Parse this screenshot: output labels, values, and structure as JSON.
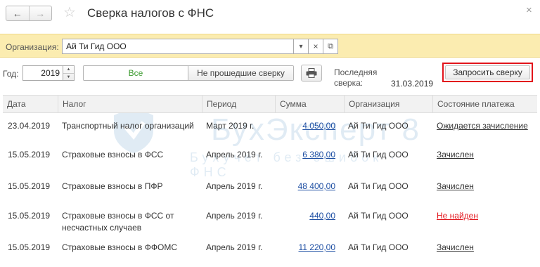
{
  "header": {
    "title": "Сверка налогов с ФНС",
    "back_icon": "←",
    "forward_icon": "→",
    "favorite_icon": "☆",
    "close_icon": "×"
  },
  "organization": {
    "label": "Организация:",
    "value": "Ай Ти Гид ООО",
    "dropdown_icon": "▾",
    "clear_icon": "×",
    "open_icon": "⧉"
  },
  "filters": {
    "year_label": "Год:",
    "year_value": "2019",
    "spin_up": "▲",
    "spin_down": "▼",
    "all_label": "Все",
    "failed_label": "Не прошедшие сверку",
    "last_label_line1": "Последняя",
    "last_label_line2": "сверка:",
    "last_date": "31.03.2019",
    "request_button": "Запросить сверку"
  },
  "watermark": {
    "title": "БухЭксперт 8",
    "subtitle": "Бухучет без ошибок  ·  ФНС"
  },
  "table": {
    "columns": [
      "Дата",
      "Налог",
      "Период",
      "Сумма",
      "Организация",
      "Состояние платежа"
    ],
    "rows": [
      {
        "date": "23.04.2019",
        "tax": "Транспортный налог организаций",
        "tax2": "",
        "period": "Март 2019 г.",
        "sum": "4 050,00",
        "org": "Ай Ти Гид ООО",
        "status": "Ожидается зачисление",
        "status_color": "#333333"
      },
      {
        "date": "15.05.2019",
        "tax": "Страховые взносы в ФСС",
        "tax2": "",
        "period": "Апрель 2019 г.",
        "sum": "6 380,00",
        "org": "Ай Ти Гид ООО",
        "status": "Зачислен",
        "status_color": "#333333"
      },
      {
        "date": "15.05.2019",
        "tax": "Страховые взносы в ПФР",
        "tax2": "",
        "period": "Апрель 2019 г.",
        "sum": "48 400,00",
        "org": "Ай Ти Гид ООО",
        "status": "Зачислен",
        "status_color": "#333333"
      },
      {
        "date": "15.05.2019",
        "tax": "Страховые взносы в ФСС от",
        "tax2": "несчастных случаев",
        "period": "Апрель 2019 г.",
        "sum": "440,00",
        "org": "Ай Ти Гид ООО",
        "status": "Не найден",
        "status_color": "#e2141b"
      },
      {
        "date": "15.05.2019",
        "tax": "Страховые взносы в ФФОМС",
        "tax2": "",
        "period": "Апрель 2019 г.",
        "sum": "11 220,00",
        "org": "Ай Ти Гид ООО",
        "status": "Зачислен",
        "status_color": "#333333"
      }
    ]
  },
  "colors": {
    "accent_red": "#e2141b",
    "org_bar": "#fbecb0",
    "link_blue": "#1e4fa3",
    "green": "#3a9a2e"
  }
}
